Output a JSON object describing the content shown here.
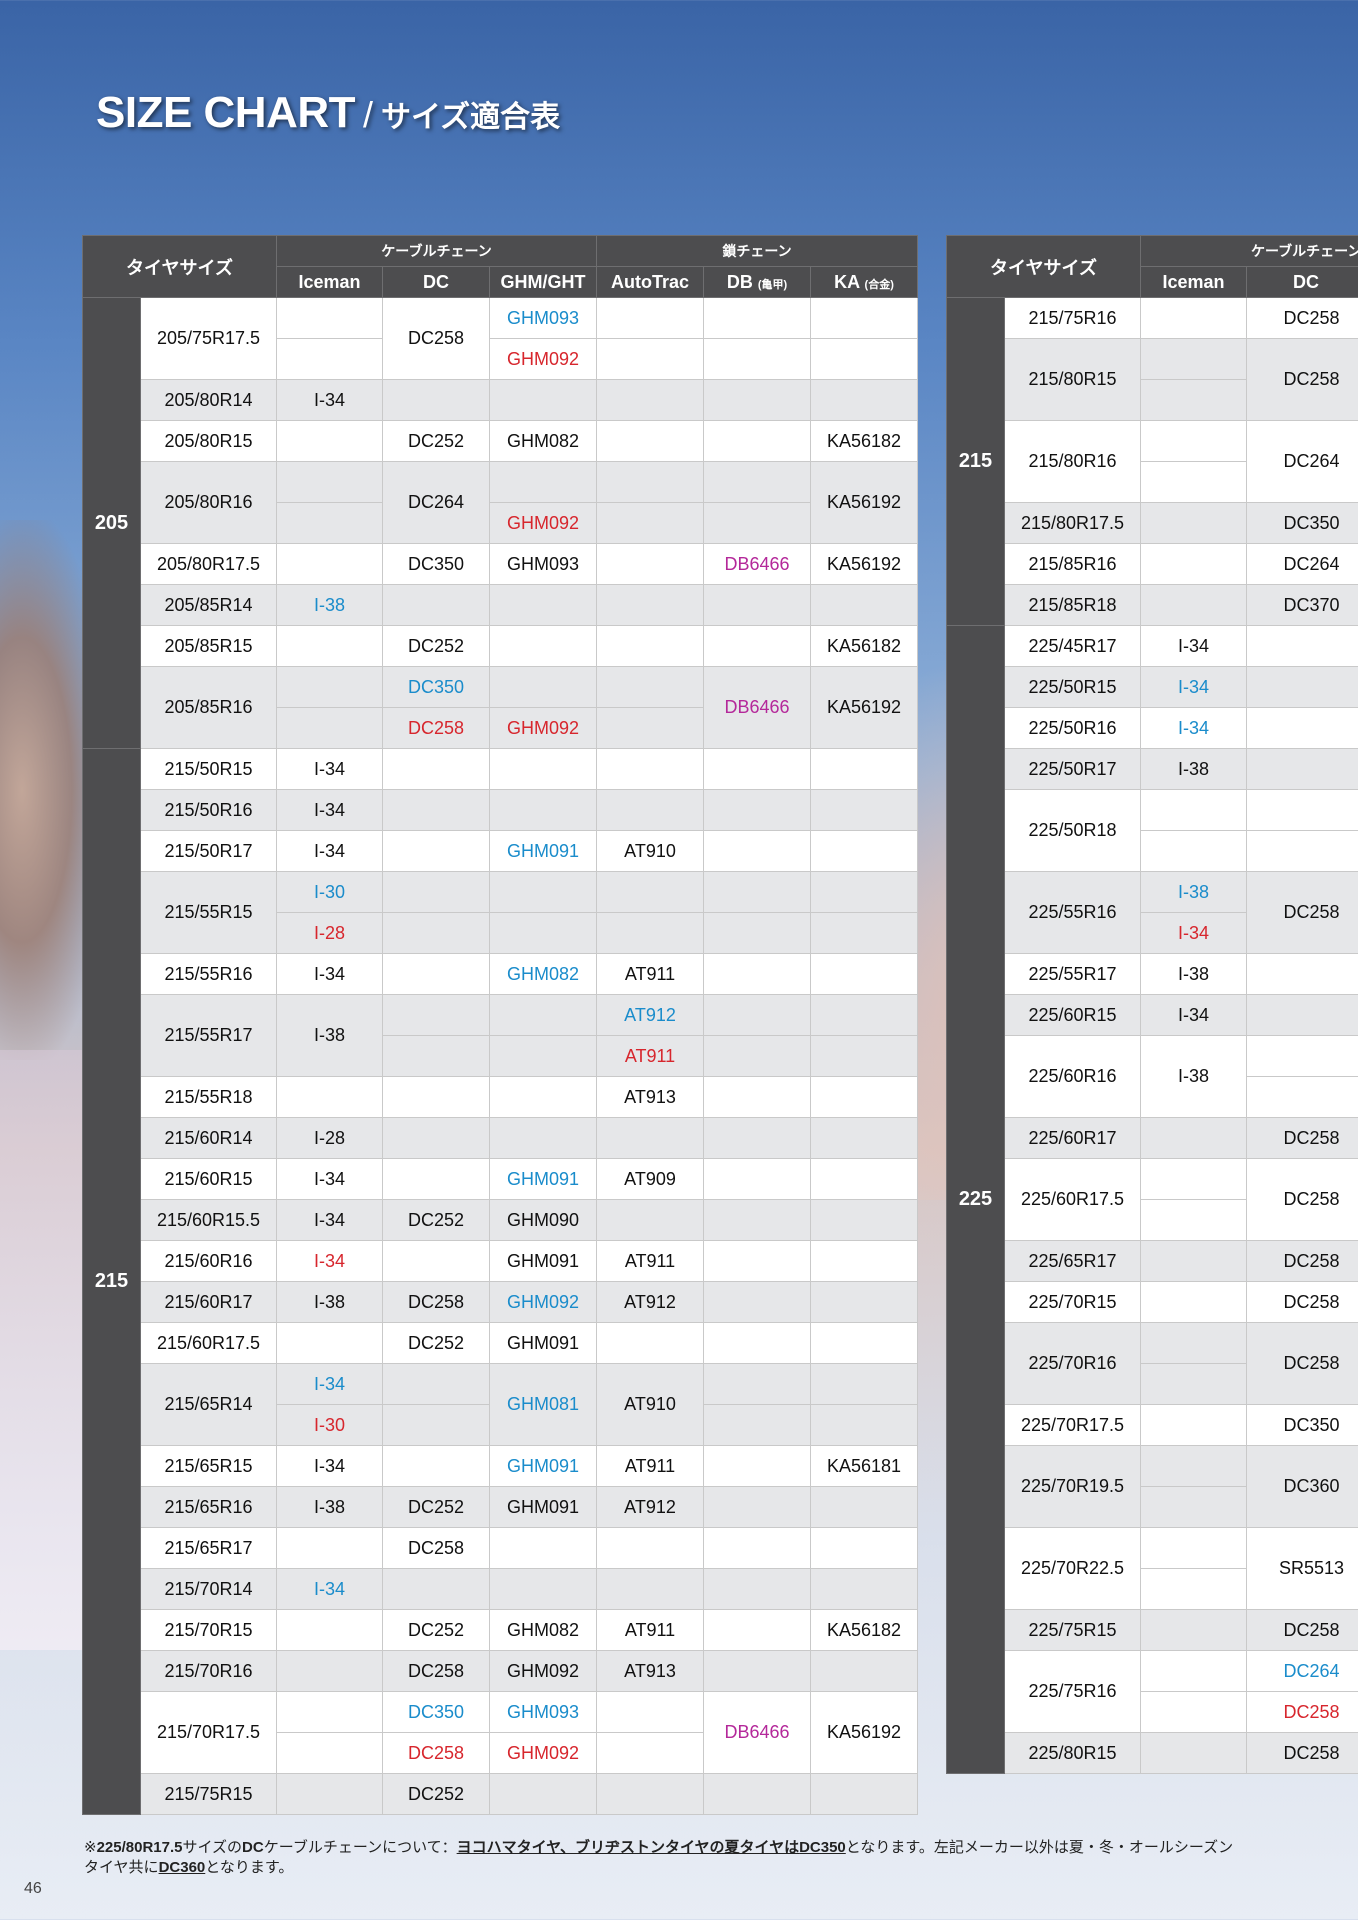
{
  "title": {
    "en": "SIZE CHART",
    "sep": "/",
    "jp": "サイズ適合表"
  },
  "headers": {
    "tire_size": "タイヤサイズ",
    "cable_group": "ケーブルチェーン",
    "chain_group": "鎖チェーン",
    "iceman": "Iceman",
    "dc": "DC",
    "ghm": "GHM/GHT",
    "autotrac": "AutoTrac",
    "db": "DB",
    "db_note": "(亀甲)",
    "ka": "KA",
    "ka_note": "(合金)",
    "cable_group_right": "ケーブルチェーン"
  },
  "left_table": [
    {
      "width": "205",
      "size": "205/75R17.5",
      "iceman": "",
      "dc": "DC258",
      "ghm": "GHM093",
      "ghm_color": "blue",
      "ghm2": "GHM092",
      "ghm2_color": "red"
    },
    {
      "size": "205/80R14",
      "iceman": "I-34"
    },
    {
      "size": "205/80R15",
      "dc": "DC252",
      "ghm": "GHM082",
      "ka": "KA56182"
    },
    {
      "size": "205/80R16",
      "dc": "DC264",
      "ghm2": "GHM092",
      "ghm2_color": "red",
      "ka": "KA56192"
    },
    {
      "size": "205/80R17.5",
      "dc": "DC350",
      "ghm": "GHM093",
      "db": "DB6466",
      "db_color": "magenta",
      "ka": "KA56192"
    },
    {
      "size": "205/85R14",
      "iceman": "I-38",
      "iceman_color": "blue"
    },
    {
      "size": "205/85R15",
      "dc": "DC252",
      "ka": "KA56182"
    },
    {
      "size": "205/85R16",
      "dc": "DC350",
      "dc_color": "blue",
      "dc2": "DC258",
      "dc2_color": "red",
      "ghm2": "GHM092",
      "ghm2_color": "red",
      "db": "DB6466",
      "db_color": "magenta",
      "ka": "KA56192"
    },
    {
      "width": "215",
      "size": "215/50R15",
      "iceman": "I-34"
    },
    {
      "size": "215/50R16",
      "iceman": "I-34"
    },
    {
      "size": "215/50R17",
      "iceman": "I-34",
      "ghm": "GHM091",
      "ghm_color": "blue",
      "at": "AT910"
    },
    {
      "size": "215/55R15",
      "iceman": "I-30",
      "iceman_color": "blue",
      "iceman2": "I-28",
      "iceman2_color": "red"
    },
    {
      "size": "215/55R16",
      "iceman": "I-34",
      "ghm": "GHM082",
      "ghm_color": "blue",
      "at": "AT911"
    },
    {
      "size": "215/55R17",
      "iceman": "I-38",
      "at": "AT912",
      "at_color": "blue",
      "at2": "AT911",
      "at2_color": "red"
    },
    {
      "size": "215/55R18",
      "at": "AT913"
    },
    {
      "size": "215/60R14",
      "iceman": "I-28"
    },
    {
      "size": "215/60R15",
      "iceman": "I-34",
      "ghm": "GHM091",
      "ghm_color": "blue",
      "at": "AT909"
    },
    {
      "size": "215/60R15.5",
      "iceman": "I-34",
      "dc": "DC252",
      "ghm": "GHM090"
    },
    {
      "size": "215/60R16",
      "iceman": "I-34",
      "iceman_color": "red",
      "ghm": "GHM091",
      "at": "AT911"
    },
    {
      "size": "215/60R17",
      "iceman": "I-38",
      "dc": "DC258",
      "ghm": "GHM092",
      "ghm_color": "blue",
      "at": "AT912"
    },
    {
      "size": "215/60R17.5",
      "dc": "DC252",
      "ghm": "GHM091"
    },
    {
      "size": "215/65R14",
      "iceman": "I-34",
      "iceman_color": "blue",
      "iceman2": "I-30",
      "iceman2_color": "red",
      "ghm": "GHM081",
      "ghm_color": "blue",
      "at": "AT910"
    },
    {
      "size": "215/65R15",
      "iceman": "I-34",
      "ghm": "GHM091",
      "ghm_color": "blue",
      "at": "AT911",
      "ka": "KA56181"
    },
    {
      "size": "215/65R16",
      "iceman": "I-38",
      "dc": "DC252",
      "ghm": "GHM091",
      "at": "AT912"
    },
    {
      "size": "215/65R17",
      "dc": "DC258"
    },
    {
      "size": "215/70R14",
      "iceman": "I-34",
      "iceman_color": "blue"
    },
    {
      "size": "215/70R15",
      "dc": "DC252",
      "ghm": "GHM082",
      "at": "AT911",
      "ka": "KA56182"
    },
    {
      "size": "215/70R16",
      "dc": "DC258",
      "ghm": "GHM092",
      "at": "AT913"
    },
    {
      "size": "215/70R17.5",
      "dc": "DC350",
      "dc_color": "blue",
      "dc2": "DC258",
      "dc2_color": "red",
      "ghm": "GHM093",
      "ghm_color": "blue",
      "ghm2": "GHM092",
      "ghm2_color": "red",
      "db": "DB6466",
      "db_color": "magenta",
      "ka": "KA56192"
    },
    {
      "size": "215/75R15",
      "dc": "DC252"
    }
  ],
  "right_table": [
    {
      "width": "215",
      "size": "215/75R16",
      "dc": "DC258"
    },
    {
      "size": "215/80R15",
      "dc": "DC258"
    },
    {
      "size": "215/80R16",
      "dc": "DC264"
    },
    {
      "size": "215/80R17.5",
      "dc": "DC350"
    },
    {
      "size": "215/85R16",
      "dc": "DC264"
    },
    {
      "size": "215/85R18",
      "dc": "DC370"
    },
    {
      "width": "225",
      "size": "225/45R17",
      "iceman": "I-34"
    },
    {
      "size": "225/50R15",
      "iceman": "I-34",
      "iceman_color": "blue"
    },
    {
      "size": "225/50R16",
      "iceman": "I-34",
      "iceman_color": "blue"
    },
    {
      "size": "225/50R17",
      "iceman": "I-38"
    },
    {
      "size": "225/50R18"
    },
    {
      "size": "225/55R16",
      "iceman": "I-38",
      "iceman_color": "blue",
      "iceman2": "I-34",
      "iceman2_color": "red",
      "dc": "DC258"
    },
    {
      "size": "225/55R17",
      "iceman": "I-38"
    },
    {
      "size": "225/60R15",
      "iceman": "I-34"
    },
    {
      "size": "225/60R16",
      "iceman": "I-38"
    },
    {
      "size": "225/60R17",
      "dc": "DC258"
    },
    {
      "size": "225/60R17.5",
      "dc": "DC258"
    },
    {
      "size": "225/65R17",
      "dc": "DC258"
    },
    {
      "size": "225/70R15",
      "dc": "DC258"
    },
    {
      "size": "225/70R16",
      "dc": "DC258"
    },
    {
      "size": "225/70R17.5",
      "dc": "DC350"
    },
    {
      "size": "225/70R19.5",
      "dc": "DC360"
    },
    {
      "size": "225/70R22.5",
      "dc": "SR5513"
    },
    {
      "size": "225/75R15",
      "dc": "DC258"
    },
    {
      "size": "225/75R16",
      "dc": "DC264",
      "dc_color": "blue",
      "dc2": "DC258",
      "dc2_color": "red"
    },
    {
      "size": "225/80R15",
      "dc": "DC258"
    }
  ],
  "footnote": {
    "line1_a": "※",
    "line1_b": "225/80R17.5",
    "line1_c": "サイズの",
    "line1_d": "DC",
    "line1_e": "ケーブルチェーンについて：",
    "line1_u": "ヨコハマタイヤ、ブリヂストンタイヤの夏タイヤは",
    "line1_dc350": "DC350",
    "line1_f": "となります。左記メーカー以外は夏・冬・オールシーズン",
    "line2_a": "タイヤ共に",
    "line2_dc360": "DC360",
    "line2_b": "となります。"
  },
  "page_number": "46",
  "colors": {
    "header_bg": "#4d4d4f",
    "stripe_bg": "#e6e7e9",
    "blue": "#1a8ccb",
    "red": "#d7262d",
    "magenta": "#b4289a"
  }
}
